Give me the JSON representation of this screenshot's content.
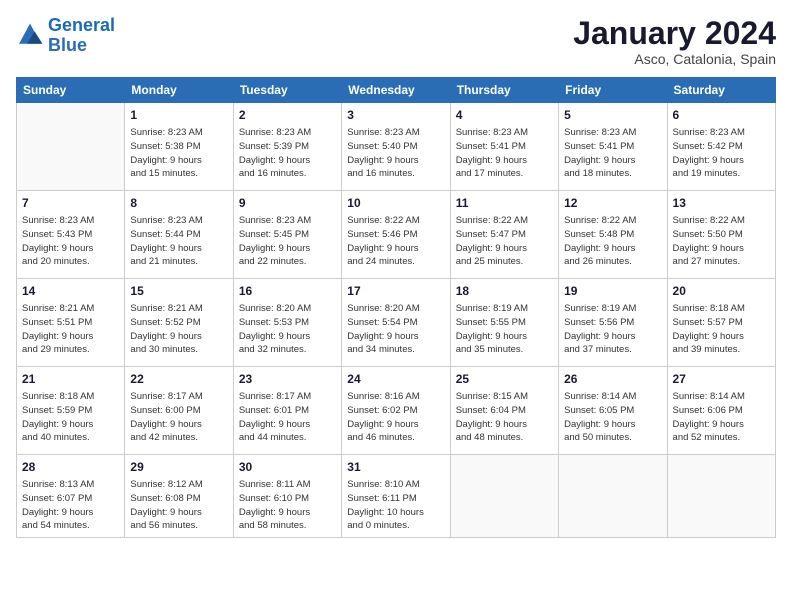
{
  "header": {
    "logo_line1": "General",
    "logo_line2": "Blue",
    "month": "January 2024",
    "location": "Asco, Catalonia, Spain"
  },
  "weekdays": [
    "Sunday",
    "Monday",
    "Tuesday",
    "Wednesday",
    "Thursday",
    "Friday",
    "Saturday"
  ],
  "weeks": [
    [
      {
        "day": "",
        "sunrise": "",
        "sunset": "",
        "daylight": ""
      },
      {
        "day": "1",
        "sunrise": "Sunrise: 8:23 AM",
        "sunset": "Sunset: 5:38 PM",
        "daylight": "Daylight: 9 hours and 15 minutes."
      },
      {
        "day": "2",
        "sunrise": "Sunrise: 8:23 AM",
        "sunset": "Sunset: 5:39 PM",
        "daylight": "Daylight: 9 hours and 16 minutes."
      },
      {
        "day": "3",
        "sunrise": "Sunrise: 8:23 AM",
        "sunset": "Sunset: 5:40 PM",
        "daylight": "Daylight: 9 hours and 16 minutes."
      },
      {
        "day": "4",
        "sunrise": "Sunrise: 8:23 AM",
        "sunset": "Sunset: 5:41 PM",
        "daylight": "Daylight: 9 hours and 17 minutes."
      },
      {
        "day": "5",
        "sunrise": "Sunrise: 8:23 AM",
        "sunset": "Sunset: 5:41 PM",
        "daylight": "Daylight: 9 hours and 18 minutes."
      },
      {
        "day": "6",
        "sunrise": "Sunrise: 8:23 AM",
        "sunset": "Sunset: 5:42 PM",
        "daylight": "Daylight: 9 hours and 19 minutes."
      }
    ],
    [
      {
        "day": "7",
        "sunrise": "Sunrise: 8:23 AM",
        "sunset": "Sunset: 5:43 PM",
        "daylight": "Daylight: 9 hours and 20 minutes."
      },
      {
        "day": "8",
        "sunrise": "Sunrise: 8:23 AM",
        "sunset": "Sunset: 5:44 PM",
        "daylight": "Daylight: 9 hours and 21 minutes."
      },
      {
        "day": "9",
        "sunrise": "Sunrise: 8:23 AM",
        "sunset": "Sunset: 5:45 PM",
        "daylight": "Daylight: 9 hours and 22 minutes."
      },
      {
        "day": "10",
        "sunrise": "Sunrise: 8:22 AM",
        "sunset": "Sunset: 5:46 PM",
        "daylight": "Daylight: 9 hours and 24 minutes."
      },
      {
        "day": "11",
        "sunrise": "Sunrise: 8:22 AM",
        "sunset": "Sunset: 5:47 PM",
        "daylight": "Daylight: 9 hours and 25 minutes."
      },
      {
        "day": "12",
        "sunrise": "Sunrise: 8:22 AM",
        "sunset": "Sunset: 5:48 PM",
        "daylight": "Daylight: 9 hours and 26 minutes."
      },
      {
        "day": "13",
        "sunrise": "Sunrise: 8:22 AM",
        "sunset": "Sunset: 5:50 PM",
        "daylight": "Daylight: 9 hours and 27 minutes."
      }
    ],
    [
      {
        "day": "14",
        "sunrise": "Sunrise: 8:21 AM",
        "sunset": "Sunset: 5:51 PM",
        "daylight": "Daylight: 9 hours and 29 minutes."
      },
      {
        "day": "15",
        "sunrise": "Sunrise: 8:21 AM",
        "sunset": "Sunset: 5:52 PM",
        "daylight": "Daylight: 9 hours and 30 minutes."
      },
      {
        "day": "16",
        "sunrise": "Sunrise: 8:20 AM",
        "sunset": "Sunset: 5:53 PM",
        "daylight": "Daylight: 9 hours and 32 minutes."
      },
      {
        "day": "17",
        "sunrise": "Sunrise: 8:20 AM",
        "sunset": "Sunset: 5:54 PM",
        "daylight": "Daylight: 9 hours and 34 minutes."
      },
      {
        "day": "18",
        "sunrise": "Sunrise: 8:19 AM",
        "sunset": "Sunset: 5:55 PM",
        "daylight": "Daylight: 9 hours and 35 minutes."
      },
      {
        "day": "19",
        "sunrise": "Sunrise: 8:19 AM",
        "sunset": "Sunset: 5:56 PM",
        "daylight": "Daylight: 9 hours and 37 minutes."
      },
      {
        "day": "20",
        "sunrise": "Sunrise: 8:18 AM",
        "sunset": "Sunset: 5:57 PM",
        "daylight": "Daylight: 9 hours and 39 minutes."
      }
    ],
    [
      {
        "day": "21",
        "sunrise": "Sunrise: 8:18 AM",
        "sunset": "Sunset: 5:59 PM",
        "daylight": "Daylight: 9 hours and 40 minutes."
      },
      {
        "day": "22",
        "sunrise": "Sunrise: 8:17 AM",
        "sunset": "Sunset: 6:00 PM",
        "daylight": "Daylight: 9 hours and 42 minutes."
      },
      {
        "day": "23",
        "sunrise": "Sunrise: 8:17 AM",
        "sunset": "Sunset: 6:01 PM",
        "daylight": "Daylight: 9 hours and 44 minutes."
      },
      {
        "day": "24",
        "sunrise": "Sunrise: 8:16 AM",
        "sunset": "Sunset: 6:02 PM",
        "daylight": "Daylight: 9 hours and 46 minutes."
      },
      {
        "day": "25",
        "sunrise": "Sunrise: 8:15 AM",
        "sunset": "Sunset: 6:04 PM",
        "daylight": "Daylight: 9 hours and 48 minutes."
      },
      {
        "day": "26",
        "sunrise": "Sunrise: 8:14 AM",
        "sunset": "Sunset: 6:05 PM",
        "daylight": "Daylight: 9 hours and 50 minutes."
      },
      {
        "day": "27",
        "sunrise": "Sunrise: 8:14 AM",
        "sunset": "Sunset: 6:06 PM",
        "daylight": "Daylight: 9 hours and 52 minutes."
      }
    ],
    [
      {
        "day": "28",
        "sunrise": "Sunrise: 8:13 AM",
        "sunset": "Sunset: 6:07 PM",
        "daylight": "Daylight: 9 hours and 54 minutes."
      },
      {
        "day": "29",
        "sunrise": "Sunrise: 8:12 AM",
        "sunset": "Sunset: 6:08 PM",
        "daylight": "Daylight: 9 hours and 56 minutes."
      },
      {
        "day": "30",
        "sunrise": "Sunrise: 8:11 AM",
        "sunset": "Sunset: 6:10 PM",
        "daylight": "Daylight: 9 hours and 58 minutes."
      },
      {
        "day": "31",
        "sunrise": "Sunrise: 8:10 AM",
        "sunset": "Sunset: 6:11 PM",
        "daylight": "Daylight: 10 hours and 0 minutes."
      },
      {
        "day": "",
        "sunrise": "",
        "sunset": "",
        "daylight": ""
      },
      {
        "day": "",
        "sunrise": "",
        "sunset": "",
        "daylight": ""
      },
      {
        "day": "",
        "sunrise": "",
        "sunset": "",
        "daylight": ""
      }
    ]
  ]
}
